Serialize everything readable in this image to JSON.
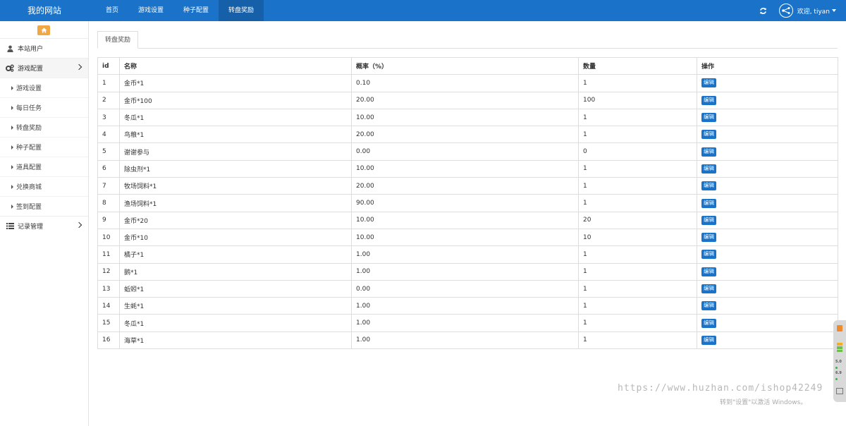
{
  "brand": "我的网站",
  "topnav": [
    {
      "label": "首页",
      "active": false
    },
    {
      "label": "游戏设置",
      "active": false
    },
    {
      "label": "种子配置",
      "active": false
    },
    {
      "label": "转盘奖励",
      "active": true
    }
  ],
  "user": {
    "welcome": "欢迎, tiyan"
  },
  "sidebar": {
    "site_users": "本站用户",
    "game_config": "游戏配置",
    "sub_items": [
      "游戏设置",
      "每日任务",
      "转盘奖励",
      "种子配置",
      "道具配置",
      "兑换商城",
      "签到配置"
    ],
    "records": "记录管理"
  },
  "tab": {
    "label": "转盘奖励"
  },
  "table": {
    "headers": {
      "id": "id",
      "name": "名称",
      "rate": "概率（%）",
      "qty": "数量",
      "ops": "操作"
    },
    "edit_label": "编辑",
    "rows": [
      {
        "id": "1",
        "name": "金币*1",
        "rate": "0.10",
        "qty": "1"
      },
      {
        "id": "2",
        "name": "金币*100",
        "rate": "20.00",
        "qty": "100"
      },
      {
        "id": "3",
        "name": "冬瓜*1",
        "rate": "10.00",
        "qty": "1"
      },
      {
        "id": "4",
        "name": "鸟粮*1",
        "rate": "20.00",
        "qty": "1"
      },
      {
        "id": "5",
        "name": "谢谢参与",
        "rate": "0.00",
        "qty": "0"
      },
      {
        "id": "6",
        "name": "除虫剂*1",
        "rate": "10.00",
        "qty": "1"
      },
      {
        "id": "7",
        "name": "牧场饲料*1",
        "rate": "20.00",
        "qty": "1"
      },
      {
        "id": "8",
        "name": "渔场饲料*1",
        "rate": "90.00",
        "qty": "1"
      },
      {
        "id": "9",
        "name": "金币*20",
        "rate": "10.00",
        "qty": "20"
      },
      {
        "id": "10",
        "name": "金币*10",
        "rate": "10.00",
        "qty": "10"
      },
      {
        "id": "11",
        "name": "橘子*1",
        "rate": "1.00",
        "qty": "1"
      },
      {
        "id": "12",
        "name": "鹅*1",
        "rate": "1.00",
        "qty": "1"
      },
      {
        "id": "13",
        "name": "蚯蚓*1",
        "rate": "0.00",
        "qty": "1"
      },
      {
        "id": "14",
        "name": "生蚝*1",
        "rate": "1.00",
        "qty": "1"
      },
      {
        "id": "15",
        "name": "冬瓜*1",
        "rate": "1.00",
        "qty": "1"
      },
      {
        "id": "16",
        "name": "海草*1",
        "rate": "1.00",
        "qty": "1"
      }
    ]
  },
  "watermark": "https://www.huzhan.com/ishop42249",
  "activate_text": "转到\"设置\"以激活 Windows。",
  "widget": {
    "v1": "5.0",
    "v2": "6.9"
  },
  "colors": {
    "primary": "#1a73c9",
    "home_button": "#f0a845"
  }
}
